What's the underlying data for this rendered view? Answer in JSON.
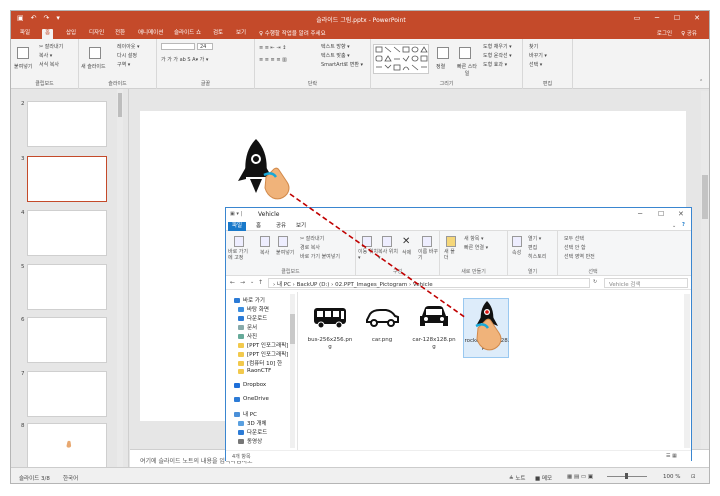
{
  "ppt": {
    "qa_icons": [
      "save-icon",
      "undo-icon",
      "redo-icon",
      "customize-icon"
    ],
    "title": "슬라이드 그림.pptx - PowerPoint",
    "window_controls": [
      "▭",
      "─",
      "☐",
      "✕"
    ],
    "tabs": [
      "파일",
      "홈",
      "삽입",
      "디자인",
      "전환",
      "애니메이션",
      "슬라이드 쇼",
      "검토",
      "보기"
    ],
    "tell_me": "♀ 수행할 작업을 알려 주세요",
    "sign_in": "로그인",
    "share": "♀ 공유",
    "ribbon": {
      "clipboard": {
        "label": "클립보드",
        "paste": "붙여넣기",
        "cut": "✂ 잘라내기",
        "copy": "복사 ▾",
        "format_painter": "서식 복사"
      },
      "slides": {
        "label": "슬라이드",
        "new": "새 슬라이드",
        "layout": "레이아웃 ▾",
        "reset": "다시 설정",
        "section": "구역 ▾"
      },
      "font": {
        "label": "글꼴",
        "size": "24",
        "buttons": "가 가 가 ab S A▾ 가 ▾"
      },
      "paragraph": {
        "label": "단락",
        "text_direction": "텍스트 방향 ▾",
        "align_text": "텍스트 맞춤 ▾",
        "smartart": "SmartArt로 변환 ▾"
      },
      "drawing": {
        "label": "그리기",
        "arrange": "정렬",
        "quick_styles": "빠른 스타일",
        "fill": "도형 채우기 ▾",
        "outline": "도형 윤곽선 ▾",
        "effects": "도형 효과 ▾"
      },
      "editing": {
        "label": "편집",
        "find": "찾기",
        "replace": "바꾸기 ▾",
        "select": "선택 ▾"
      }
    },
    "slide_numbers": [
      "2",
      "3",
      "4",
      "5",
      "6",
      "7",
      "8"
    ],
    "notes_placeholder": "여기에 슬라이드 노트의 내용을 입력하십시오",
    "status": {
      "slide": "슬라이드 3/8",
      "language": "한국어",
      "notes": "≜ 노트",
      "comments": "■ 메모",
      "zoom": "100 %"
    }
  },
  "explorer": {
    "title": "Vehicle",
    "tabs": [
      "파일",
      "홈",
      "공유",
      "보기"
    ],
    "ribbon": {
      "clipboard": {
        "label": "클립보드",
        "pin": "바로 가기에 고정",
        "copy": "복사",
        "paste": "붙여넣기",
        "cut": "✂ 잘라내기",
        "copy_path": "경로 복사",
        "paste_shortcut": "바로 가기 붙여넣기"
      },
      "organize": {
        "label": "구성",
        "move": "이동 위치 ▾",
        "copy_to": "복사 위치 ▾",
        "delete": "삭제",
        "rename": "이름 바꾸기"
      },
      "new": {
        "label": "새로 만들기",
        "new_folder": "새 폴더",
        "new_item": "새 항목 ▾",
        "easy_access": "빠른 연결 ▾"
      },
      "open": {
        "label": "열기",
        "properties": "속성",
        "open": "열기 ▾",
        "edit": "편집",
        "history": "히스토리"
      },
      "select": {
        "label": "선택",
        "all": "모두 선택",
        "none": "선택 안 함",
        "invert": "선택 영역 반전"
      }
    },
    "path": "› 내 PC  ›  BackUP (D:)  ›  02.PPT_Images_Pictogram  ›  Vehicle",
    "search_placeholder": "Vehicle 검색",
    "nav": [
      "바로 가기",
      "바탕 화면",
      "다운로드",
      "문서",
      "사진",
      "[PPT 인포그래픽]",
      "[PPT 인포그래픽]",
      "[컴퓨터 10] 한",
      "RaonCTF",
      "Dropbox",
      "OneDrive",
      "내 PC",
      "3D 개체",
      "다운로드",
      "동영상"
    ],
    "files": [
      {
        "name": "bus-256x256.png",
        "icon": "bus-icon"
      },
      {
        "name": "car.png",
        "icon": "car-icon"
      },
      {
        "name": "car-128x128.png",
        "icon": "car-front-icon"
      },
      {
        "name": "rocket-128x128.png",
        "icon": "rocket-icon"
      }
    ],
    "status_count": "4개 항목"
  }
}
